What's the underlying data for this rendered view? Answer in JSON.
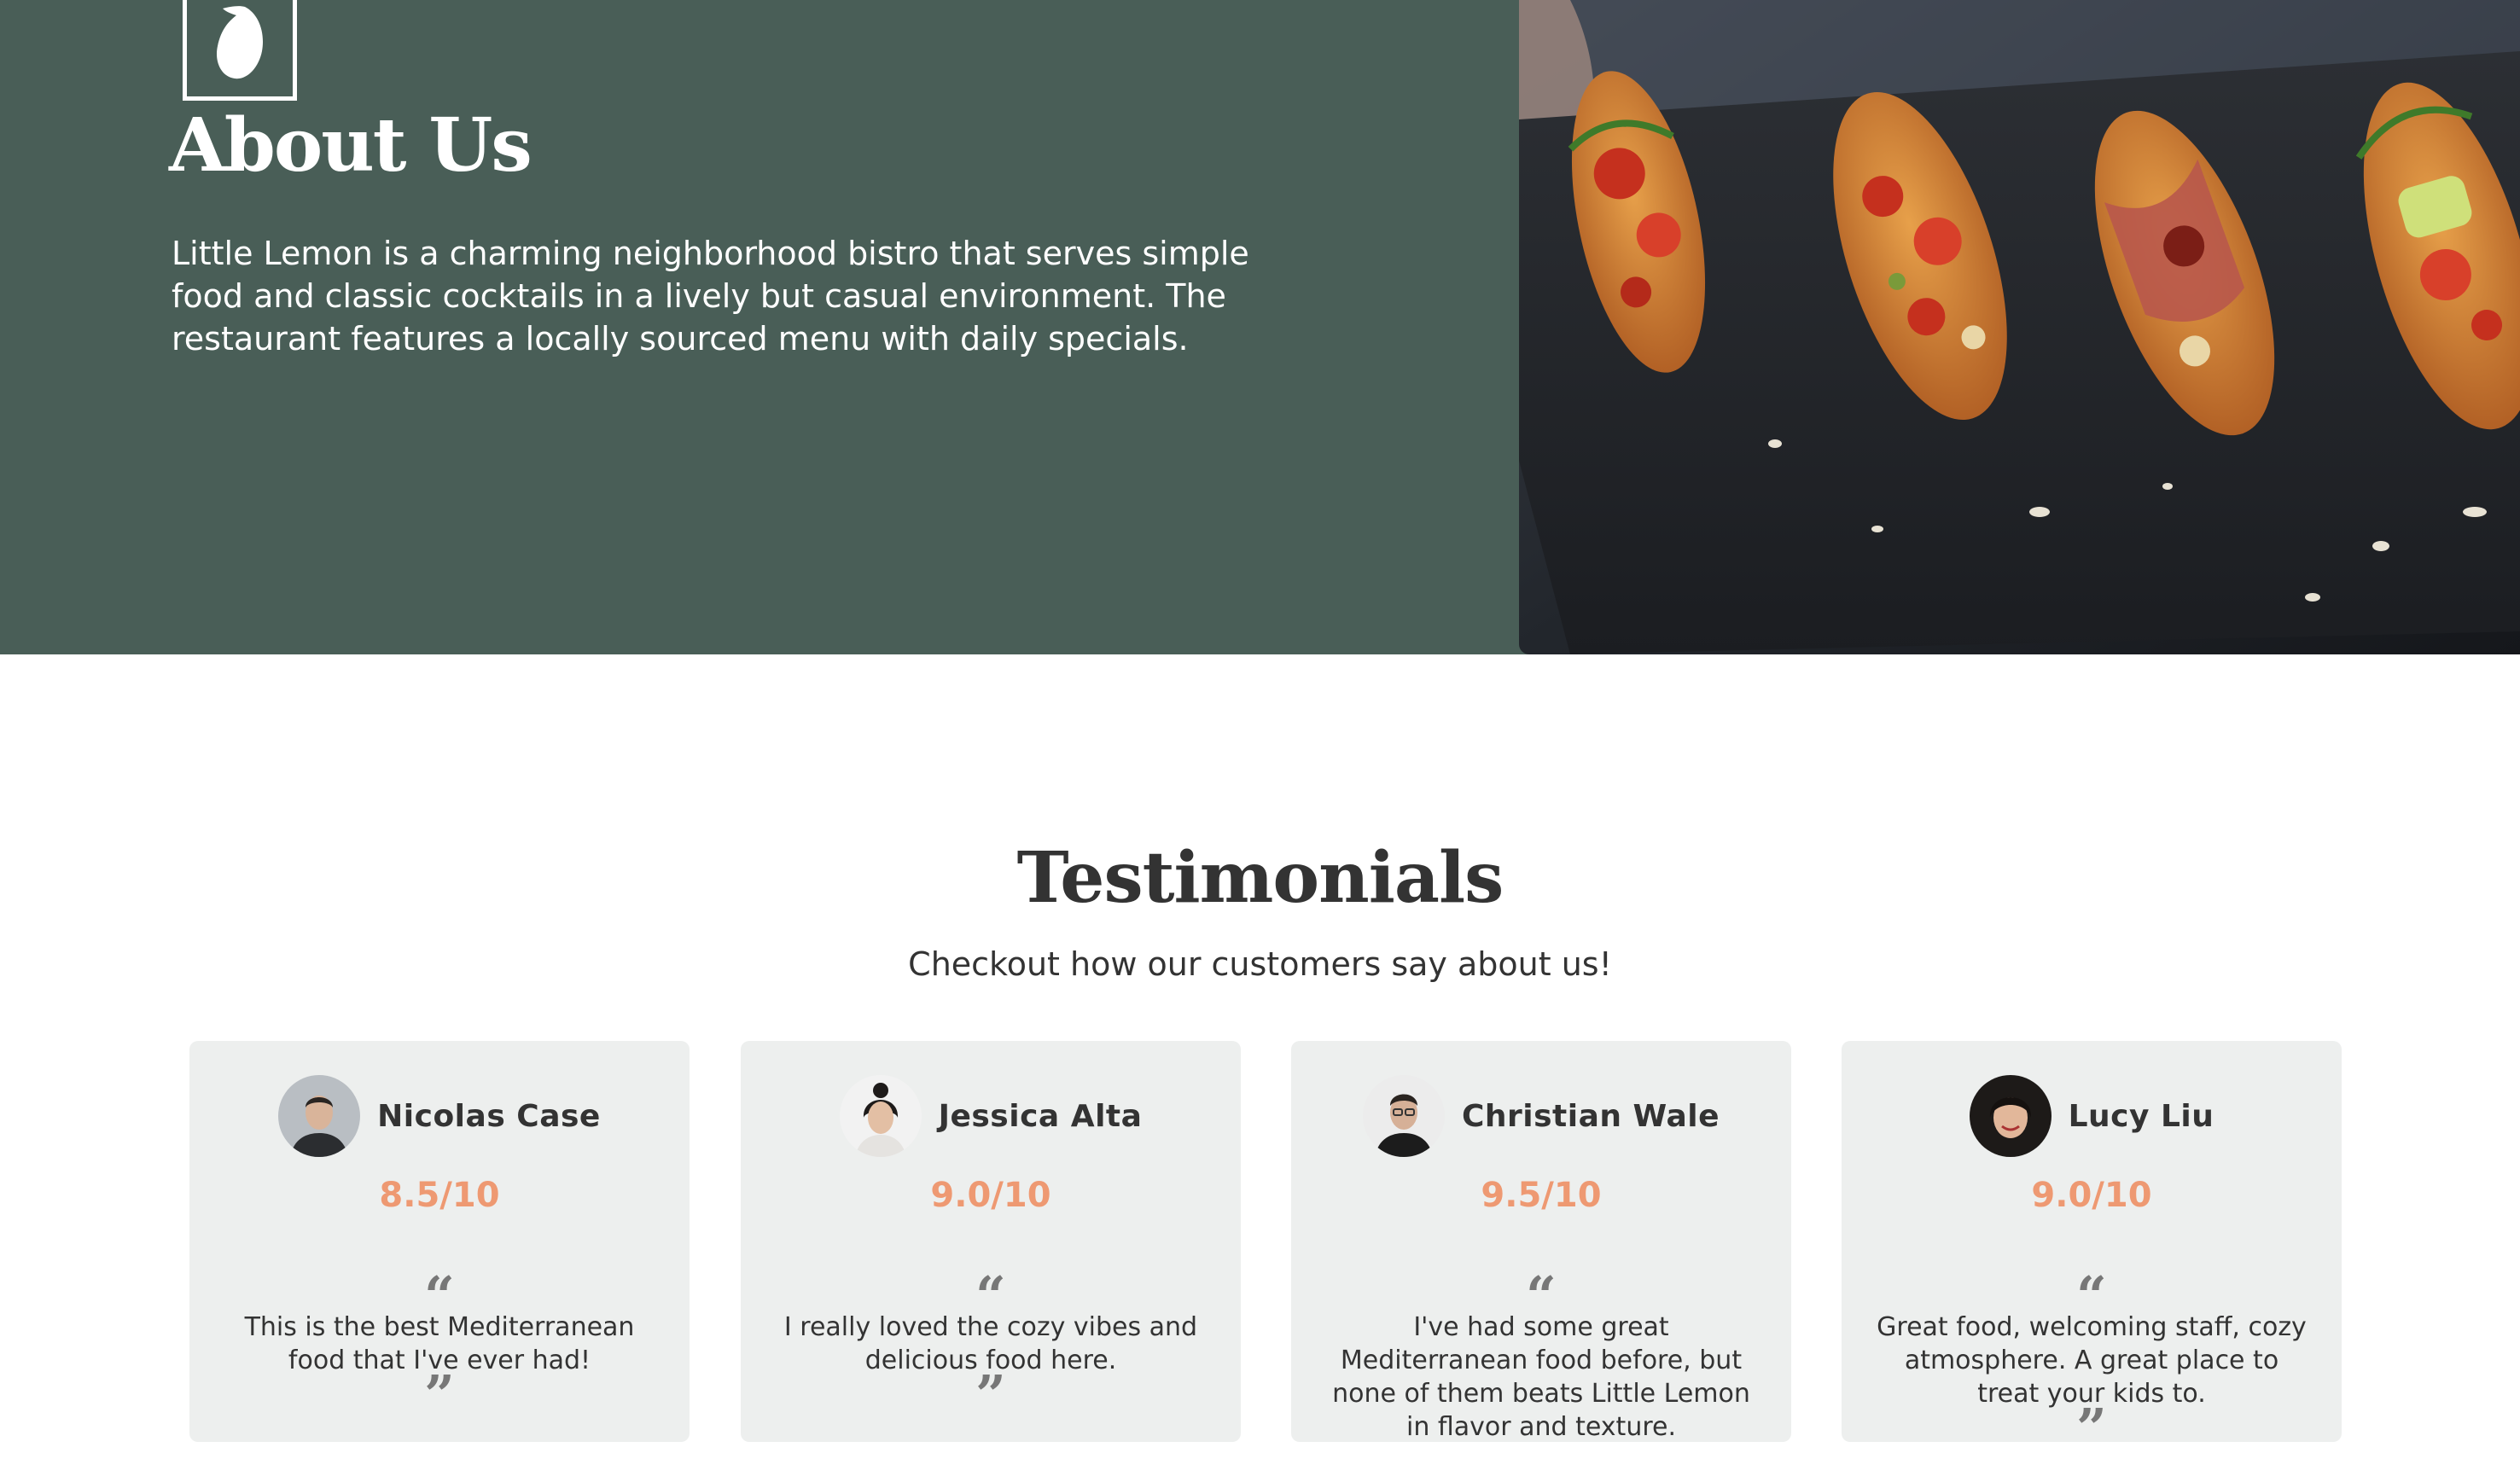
{
  "about": {
    "title": "About Us",
    "description": "Little Lemon is a charming neighborhood bistro that serves simple food and classic cocktails in a lively but casual environment. The restaurant features a locally sourced menu with daily specials.",
    "logo_icon": "lemon-logo-icon",
    "background_color": "#495e57"
  },
  "testimonials": {
    "title": "Testimonials",
    "subtitle": "Checkout how our customers say about us!",
    "quote_open": "“",
    "quote_close": "”",
    "rating_color": "#ee9972",
    "cards": [
      {
        "name": "Nicolas Case",
        "rating": "8.5/10",
        "text": "This is the best Mediterranean food that I've ever had!"
      },
      {
        "name": "Jessica Alta",
        "rating": "9.0/10",
        "text": "I really loved the cozy vibes and delicious food here."
      },
      {
        "name": "Christian Wale",
        "rating": "9.5/10",
        "text": "I've had some great Mediterranean food before, but none of them beats Little Lemon in flavor and texture."
      },
      {
        "name": "Lucy Liu",
        "rating": "9.0/10",
        "text": "Great food, welcoming staff, cozy atmosphere. A great place to treat your kids to."
      }
    ]
  }
}
